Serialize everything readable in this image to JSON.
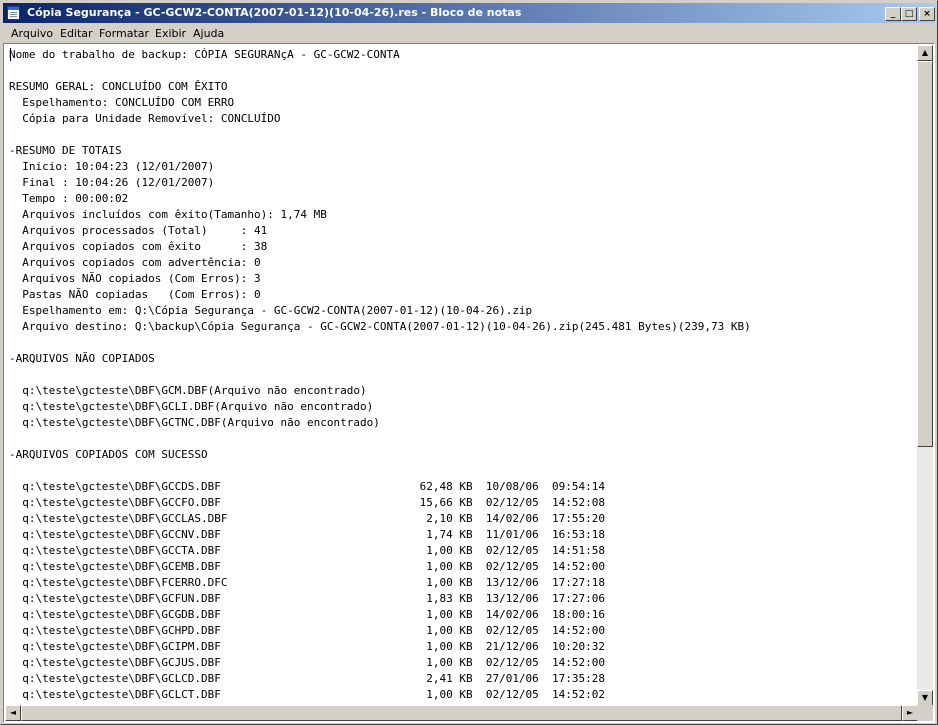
{
  "window": {
    "title": "Cópia Segurança - GC-GCW2-CONTA(2007-01-12)(10-04-26).res - Bloco de notas",
    "minimize_glyph": "_",
    "maximize_glyph": "□",
    "close_glyph": "×"
  },
  "menu": [
    {
      "label": "Arquivo"
    },
    {
      "label": "Editar"
    },
    {
      "label": "Formatar"
    },
    {
      "label": "Exibir"
    },
    {
      "label": "Ajuda"
    }
  ],
  "scrollbars": {
    "up_glyph": "▲",
    "down_glyph": "▼",
    "left_glyph": "◄",
    "right_glyph": "►"
  },
  "document": {
    "lines": [
      "Nome do trabalho de backup: CÓPIA SEGURANçA - GC-GCW2-CONTA",
      "",
      "RESUMO GERAL: CONCLUÍDO COM ÊXITO",
      "  Espelhamento: CONCLUÍDO COM ERRO",
      "  Cópia para Unidade Removível: CONCLUÍDO",
      "",
      "-RESUMO DE TOTAIS",
      "  Inicio: 10:04:23 (12/01/2007)",
      "  Final : 10:04:26 (12/01/2007)",
      "  Tempo : 00:00:02",
      "  Arquivos incluídos com êxito(Tamanho): 1,74 MB",
      "  Arquivos processados (Total)     : 41",
      "  Arquivos copiados com êxito      : 38",
      "  Arquivos copiados com advertência: 0",
      "  Arquivos NÃO copiados (Com Erros): 3",
      "  Pastas NÃO copiadas   (Com Erros): 0",
      "  Espelhamento em: Q:\\Cópia Segurança - GC-GCW2-CONTA(2007-01-12)(10-04-26).zip",
      "  Arquivo destino: Q:\\backup\\Cópia Segurança - GC-GCW2-CONTA(2007-01-12)(10-04-26).zip(245.481 Bytes)(239,73 KB)",
      "",
      "-ARQUIVOS NÃO COPIADOS",
      "",
      "  q:\\teste\\gcteste\\DBF\\GCM.DBF(Arquivo não encontrado)",
      "  q:\\teste\\gcteste\\DBF\\GCLI.DBF(Arquivo não encontrado)",
      "  q:\\teste\\gcteste\\DBF\\GCTNC.DBF(Arquivo não encontrado)",
      "",
      "-ARQUIVOS COPIADOS COM SUCESSO",
      "",
      "  q:\\teste\\gcteste\\DBF\\GCCDS.DBF                              62,48 KB  10/08/06  09:54:14",
      "  q:\\teste\\gcteste\\DBF\\GCCFO.DBF                              15,66 KB  02/12/05  14:52:08",
      "  q:\\teste\\gcteste\\DBF\\GCCLAS.DBF                              2,10 KB  14/02/06  17:55:20",
      "  q:\\teste\\gcteste\\DBF\\GCCNV.DBF                               1,74 KB  11/01/06  16:53:18",
      "  q:\\teste\\gcteste\\DBF\\GCCTA.DBF                               1,00 KB  02/12/05  14:51:58",
      "  q:\\teste\\gcteste\\DBF\\GCEMB.DBF                               1,00 KB  02/12/05  14:52:00",
      "  q:\\teste\\gcteste\\DBF\\FCERRO.DFC                              1,00 KB  13/12/06  17:27:18",
      "  q:\\teste\\gcteste\\DBF\\GCFUN.DBF                               1,83 KB  13/12/06  17:27:06",
      "  q:\\teste\\gcteste\\DBF\\GCGDB.DBF                               1,00 KB  14/02/06  18:00:16",
      "  q:\\teste\\gcteste\\DBF\\GCHPD.DBF                               1,00 KB  02/12/05  14:52:00",
      "  q:\\teste\\gcteste\\DBF\\GCIPM.DBF                               1,00 KB  21/12/06  10:20:32",
      "  q:\\teste\\gcteste\\DBF\\GCJUS.DBF                               1,00 KB  02/12/05  14:52:00",
      "  q:\\teste\\gcteste\\DBF\\GCLCD.DBF                               2,41 KB  27/01/06  17:35:28",
      "  q:\\teste\\gcteste\\DBF\\GCLCT.DBF                               1,00 KB  02/12/05  14:52:02"
    ]
  }
}
